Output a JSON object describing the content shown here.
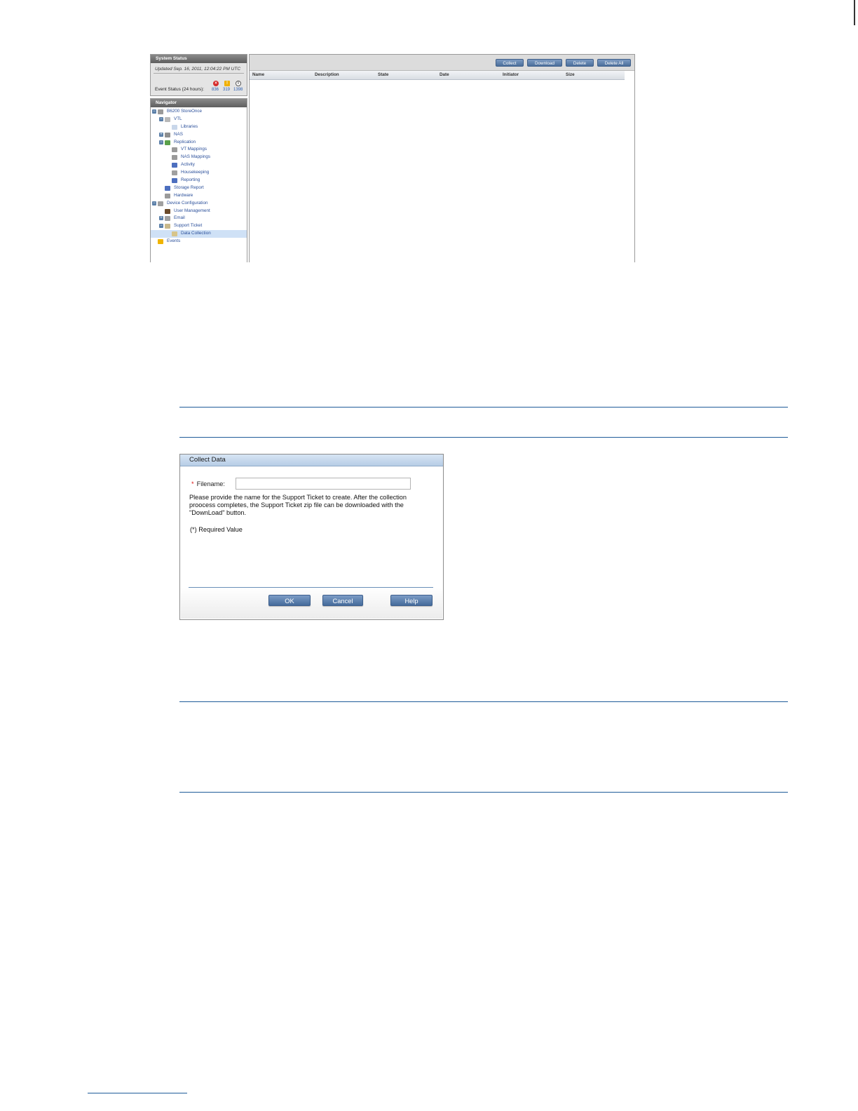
{
  "system_status": {
    "title": "System Status",
    "updated": "Updated Sep. 16, 2011, 12:04:22 PM UTC",
    "event_label": "Event Status (24 hours):",
    "counts": {
      "critical": "836",
      "warning": "319",
      "info": "1398"
    }
  },
  "navigator": {
    "title": "Navigator",
    "items": [
      {
        "label": "B6200 StoreOnce",
        "level": 0,
        "expander": "−",
        "icon": "server-icon",
        "color": "#9a9a9a"
      },
      {
        "label": "VTL",
        "level": 1,
        "expander": "−",
        "icon": "tape-drive-icon",
        "color": "#b8b8b8"
      },
      {
        "label": "Libraries",
        "level": 2,
        "expander": "",
        "icon": "library-icon",
        "color": "#c9d7ea"
      },
      {
        "label": "NAS",
        "level": 1,
        "expander": "+",
        "icon": "nas-icon",
        "color": "#8f8f8f"
      },
      {
        "label": "Replication",
        "level": 1,
        "expander": "−",
        "icon": "replication-icon",
        "color": "#5aa04a"
      },
      {
        "label": "VT Mappings",
        "level": 2,
        "expander": "",
        "icon": "mapping-icon",
        "color": "#9a9a9a"
      },
      {
        "label": "NAS Mappings",
        "level": 2,
        "expander": "",
        "icon": "mapping-icon",
        "color": "#9a9a9a"
      },
      {
        "label": "Activity",
        "level": 2,
        "expander": "",
        "icon": "activity-chart-icon",
        "color": "#4d6fbf"
      },
      {
        "label": "Housekeeping",
        "level": 2,
        "expander": "",
        "icon": "housekeeping-gear-icon",
        "color": "#a0a0a0"
      },
      {
        "label": "Reporting",
        "level": 2,
        "expander": "",
        "icon": "reporting-chart-icon",
        "color": "#4d6fbf"
      },
      {
        "label": "Storage Report",
        "level": 1,
        "expander": "",
        "icon": "storage-chart-icon",
        "color": "#4d6fbf"
      },
      {
        "label": "Hardware",
        "level": 1,
        "expander": "",
        "icon": "hardware-icon",
        "color": "#9a9a9a"
      },
      {
        "label": "Device Configuration",
        "level": 0,
        "expander": "−",
        "icon": "config-gear-icon",
        "color": "#a0a0a0"
      },
      {
        "label": "User Management",
        "level": 1,
        "expander": "",
        "icon": "user-icon",
        "color": "#6b4a2a"
      },
      {
        "label": "Email",
        "level": 1,
        "expander": "+",
        "icon": "email-icon",
        "color": "#a0a0a0"
      },
      {
        "label": "Support Ticket",
        "level": 1,
        "expander": "−",
        "icon": "ticket-icon",
        "color": "#c8b88a"
      },
      {
        "label": "Data Collection",
        "level": 2,
        "expander": "",
        "icon": "data-collection-icon",
        "color": "#d7c48a",
        "selected": true
      },
      {
        "label": "Events",
        "level": 0,
        "expander": "",
        "icon": "events-lightning-icon",
        "color": "#f0b400"
      }
    ]
  },
  "toolbar": {
    "collect": "Collect",
    "download": "Download",
    "delete": "Delete",
    "delete_all": "Delete All"
  },
  "table": {
    "columns": [
      "Name",
      "Description",
      "State",
      "Date",
      "Initiator",
      "Size"
    ]
  },
  "dialog": {
    "title": "Collect Data",
    "filename_label": "Filename:",
    "filename_value": "",
    "help_text": "Please provide the name for the Support Ticket to create. After the collection proocess completes, the Support Ticket zip file can be downloaded with the \"DownLoad\" button.",
    "required_note": "(*) Required Value",
    "ok": "OK",
    "cancel": "Cancel",
    "help": "Help"
  }
}
